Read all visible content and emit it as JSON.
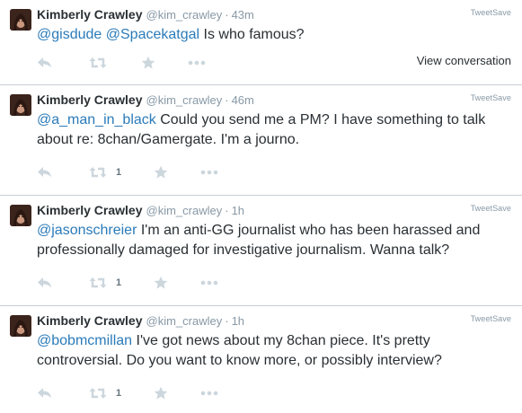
{
  "brand_label": "TweetSave",
  "colors": {
    "mention": "#2b7bb9",
    "meta": "#8899a6",
    "icon": "#ccd6dd",
    "divider": "#c8ced3"
  },
  "icons": {
    "reply": "reply-arrow-icon",
    "retweet": "retweet-icon",
    "favorite": "star-icon",
    "more": "more-dots-icon"
  },
  "tweets": [
    {
      "name": "Kimberly Crawley",
      "handle": "@kim_crawley",
      "time": "43m",
      "mentions": [
        "@gisdude",
        "@Spacekatgal"
      ],
      "text": "Is who famous?",
      "retweets": "",
      "view_conversation": "View conversation"
    },
    {
      "name": "Kimberly Crawley",
      "handle": "@kim_crawley",
      "time": "46m",
      "mentions": [
        "@a_man_in_black"
      ],
      "text": "Could you send me a PM? I have something to talk about re: 8chan/Gamergate. I'm a journo.",
      "retweets": "1"
    },
    {
      "name": "Kimberly Crawley",
      "handle": "@kim_crawley",
      "time": "1h",
      "mentions": [
        "@jasonschreier"
      ],
      "text": "I'm an anti-GG journalist who has been harassed and professionally damaged for investigative journalism. Wanna talk?",
      "retweets": "1"
    },
    {
      "name": "Kimberly Crawley",
      "handle": "@kim_crawley",
      "time": "1h",
      "mentions": [
        "@bobmcmillan"
      ],
      "text": "I've got news about my 8chan piece. It's pretty controversial. Do you want to know more, or possibly interview?",
      "retweets": "1"
    }
  ]
}
